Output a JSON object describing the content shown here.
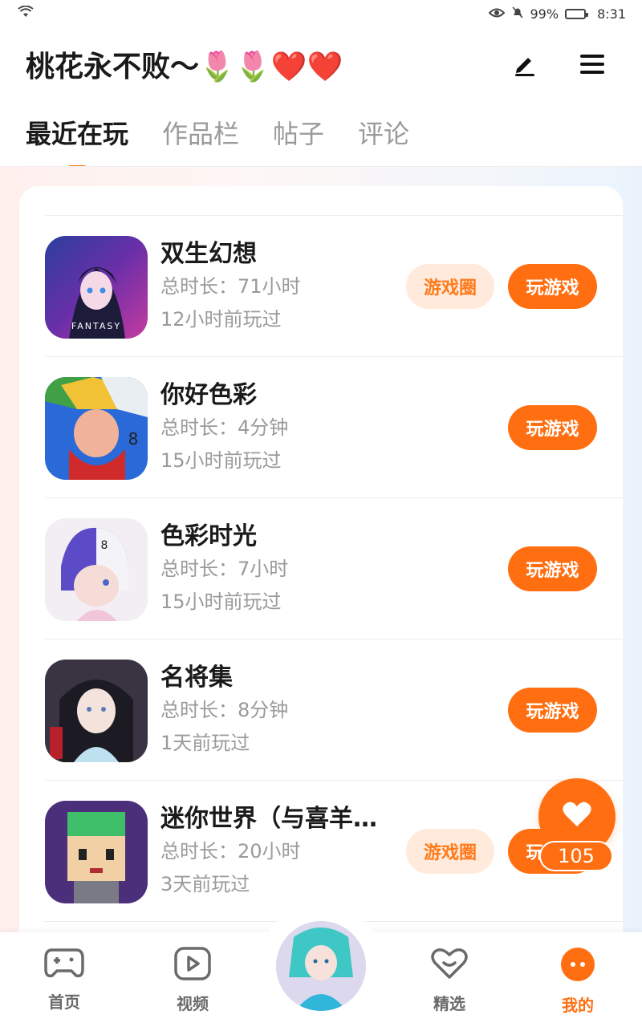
{
  "status_bar": {
    "battery": "99%",
    "time": "8:31"
  },
  "header": {
    "profile_name": "桃花永不败～🌷🌷❤️❤️",
    "edit_icon": "edit-icon",
    "menu_icon": "menu-icon"
  },
  "tabs": [
    {
      "label": "最近在玩",
      "active": true
    },
    {
      "label": "作品栏",
      "active": false
    },
    {
      "label": "帖子",
      "active": false
    },
    {
      "label": "评论",
      "active": false
    }
  ],
  "games": [
    {
      "title": "双生幻想",
      "duration": "总时长：71小时",
      "last_played": "12小时前玩过",
      "circle_label": "游戏圈",
      "play_label": "玩游戏",
      "icon_text": "FANTASY"
    },
    {
      "title": "你好色彩",
      "duration": "总时长：4分钟",
      "last_played": "15小时前玩过",
      "play_label": "玩游戏"
    },
    {
      "title": "色彩时光",
      "duration": "总时长：7小时",
      "last_played": "15小时前玩过",
      "play_label": "玩游戏"
    },
    {
      "title": "名将集",
      "duration": "总时长：8分钟",
      "last_played": "1天前玩过",
      "play_label": "玩游戏"
    },
    {
      "title": "迷你世界（与喜羊…",
      "duration": "总时长：20小时",
      "last_played": "3天前玩过",
      "circle_label": "游戏圈",
      "play_label": "玩游戏"
    }
  ],
  "like": {
    "count": "105"
  },
  "bottom_nav": [
    {
      "label": "首页",
      "icon": "gamepad-icon"
    },
    {
      "label": "视频",
      "icon": "video-icon"
    },
    {
      "label": "",
      "icon": "avatar"
    },
    {
      "label": "精选",
      "icon": "heart-icon"
    },
    {
      "label": "我的",
      "icon": "profile-icon",
      "active": true
    }
  ],
  "colors": {
    "accent": "#ff6f12",
    "accent_light": "#ffeadc"
  }
}
